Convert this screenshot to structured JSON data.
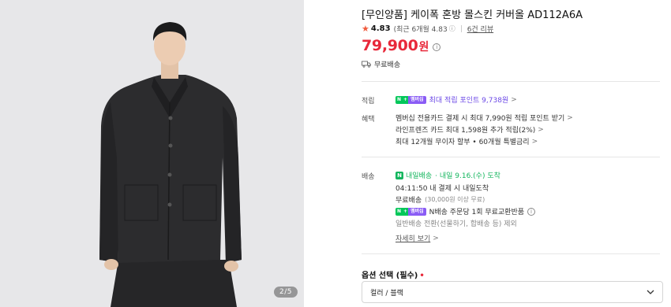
{
  "image": {
    "page_indicator": "2/5"
  },
  "product": {
    "title": "[무인양품] 케이폭 혼방 몰스킨 커버올 AD112A6A",
    "rating": "4.83",
    "rating_recent": "(최근 6개월 4.83",
    "rating_info": "ⓘ",
    "review_count": "6건 리뷰",
    "price": "79,900",
    "price_unit": "원",
    "free_shipping": "무료배송"
  },
  "accumulate": {
    "label": "적립",
    "badge_n": "N",
    "badge_plus": "+",
    "badge_member": "멤버십",
    "text": "최대 적립 포인트 9,738원",
    "chevron": ">"
  },
  "benefits": {
    "label": "혜택",
    "lines": [
      "멤버십 전용카드 결제 시 최대 7,990원 적립 포인트 받기",
      "라인프렌즈 카드 최대 1,598원 추가 적립(2%)",
      "최대 12개월 무이자 할부 • 60개월 특별금리"
    ],
    "chevron": ">"
  },
  "delivery": {
    "label": "배송",
    "tomorrow_badge": "N",
    "tomorrow_text": "내일배송",
    "eta": "· 내일 9.16.(수) 도착",
    "cutoff": "04:11:50  내 결제 시 내일도착",
    "free_shipping": "무료배송",
    "free_shipping_condition": "(30,000원 이상 무료)",
    "n_return": "N배송 주문당 1회 무료교환반품",
    "normal_shipping": "일반배송 전환(선물하기, 합배송 등) 제외",
    "more": "자세히 보기",
    "chevron": ">"
  },
  "option": {
    "label": "옵션 선택 (필수)",
    "required_mark": "•",
    "selected": "컬러 / 블랙",
    "dropdown_icon": "chevron-down-icon"
  },
  "colors": {
    "price_red": "#e8283a",
    "star_orange": "#f05a3c",
    "membership_purple": "#6a47e6",
    "delivery_green": "#14b65e"
  }
}
